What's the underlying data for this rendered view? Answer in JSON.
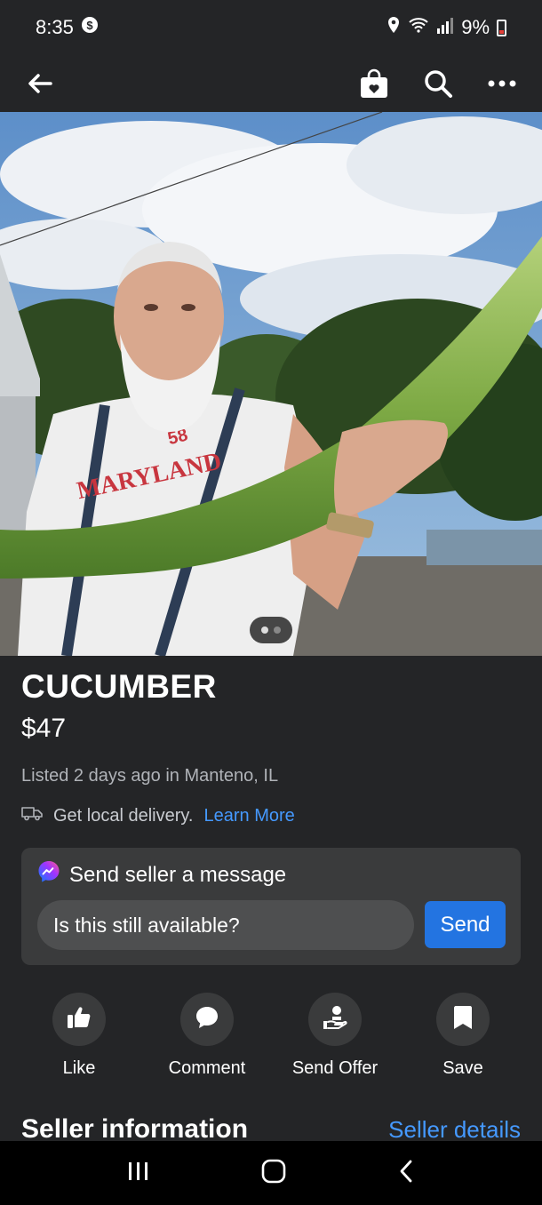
{
  "status": {
    "time": "8:35",
    "battery": "9%"
  },
  "listing": {
    "title": "CUCUMBER",
    "price": "$47",
    "listed": "Listed 2 days ago in Manteno, IL",
    "delivery_text": "Get local delivery.",
    "delivery_link": "Learn More"
  },
  "message": {
    "header": "Send seller a message",
    "input_value": "Is this still available?",
    "send_label": "Send"
  },
  "actions": [
    {
      "label": "Like",
      "icon": "thumbs-up-icon"
    },
    {
      "label": "Comment",
      "icon": "comment-icon"
    },
    {
      "label": "Send Offer",
      "icon": "send-offer-icon"
    },
    {
      "label": "Save",
      "icon": "bookmark-icon"
    }
  ],
  "seller": {
    "title": "Seller information",
    "details_link": "Seller details"
  },
  "hero": {
    "shirt_text": "MARYLAND",
    "shirt_number": "58",
    "page_count": 2,
    "current_page": 1
  },
  "colors": {
    "accent": "#2374e1",
    "link": "#4599ff",
    "background": "#242527",
    "card": "#3a3b3c"
  }
}
